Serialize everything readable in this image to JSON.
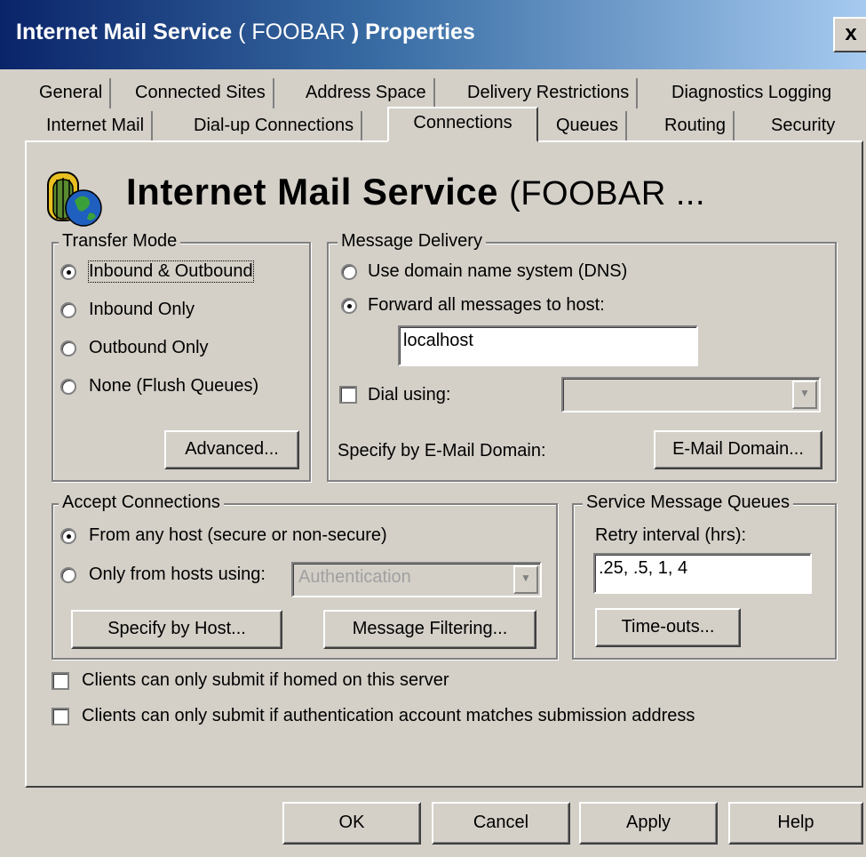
{
  "window": {
    "title_prefix": "Internet Mail Service",
    "title_server": "( FOOBAR",
    "title_suffix": ") Properties",
    "close_label": "x"
  },
  "tabs_row1": [
    "General",
    "Connected Sites",
    "Address Space",
    "Delivery Restrictions",
    "Diagnostics Logging"
  ],
  "tabs_row2": [
    "Internet Mail",
    "Dial-up Connections",
    "Connections",
    "Queues",
    "Routing",
    "Security"
  ],
  "active_tab": "Connections",
  "header": {
    "title": "Internet Mail Service",
    "server": "(FOOBAR ...",
    "icon": "globe-gate-icon"
  },
  "transfer_mode": {
    "legend": "Transfer Mode",
    "options": [
      "Inbound & Outbound",
      "Inbound Only",
      "Outbound Only",
      "None (Flush Queues)"
    ],
    "selected": "Inbound & Outbound",
    "advanced_button": "Advanced..."
  },
  "message_delivery": {
    "legend": "Message Delivery",
    "dns_option": "Use domain name system (DNS)",
    "forward_option": "Forward all messages to host:",
    "selected": "forward",
    "host_value": "localhost",
    "dial_using_label": "Dial using:",
    "dial_using_checked": false,
    "dial_using_value": "",
    "specify_label": "Specify by E-Mail Domain:",
    "email_domain_button": "E-Mail Domain..."
  },
  "accept_connections": {
    "legend": "Accept Connections",
    "any_host_option": "From any host (secure or non-secure)",
    "only_from_option": "Only from hosts using:",
    "selected": "any_host",
    "auth_select_value": "Authentication",
    "specify_by_host_button": "Specify by Host...",
    "message_filtering_button": "Message Filtering..."
  },
  "service_queues": {
    "legend": "Service Message Queues",
    "retry_label": "Retry interval (hrs):",
    "retry_value": ".25, .5, 1, 4",
    "timeouts_button": "Time-outs..."
  },
  "checkboxes": {
    "homed_label": "Clients can only submit if homed on this server",
    "homed_checked": false,
    "auth_match_label": "Clients can only submit if authentication account matches submission address",
    "auth_match_checked": false
  },
  "footer": {
    "ok": "OK",
    "cancel": "Cancel",
    "apply": "Apply",
    "help": "Help"
  },
  "colors": {
    "titlebar_start": "#0a246a",
    "titlebar_end": "#a6caf0",
    "face": "#d4d0c8"
  }
}
